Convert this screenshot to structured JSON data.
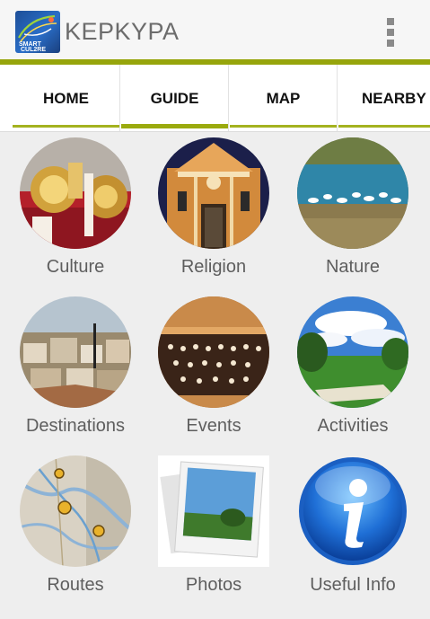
{
  "app": {
    "title": "ΚΕΡΚΥΡΑ",
    "logo_text_top": "SMART",
    "logo_text_bottom": "CUL2RE"
  },
  "tabs": [
    {
      "label": "HOME",
      "active": false
    },
    {
      "label": "GUIDE",
      "active": true
    },
    {
      "label": "MAP",
      "active": false
    },
    {
      "label": "NEARBY",
      "active": false
    }
  ],
  "categories": [
    {
      "label": "Culture"
    },
    {
      "label": "Religion"
    },
    {
      "label": "Nature"
    },
    {
      "label": "Destinations"
    },
    {
      "label": "Events"
    },
    {
      "label": "Activities"
    },
    {
      "label": "Routes"
    },
    {
      "label": "Photos"
    },
    {
      "label": "Useful Info"
    }
  ],
  "colors": {
    "accent": "#96a50b",
    "tab_indicator": "#a4b21f",
    "background": "#eeeeee"
  },
  "icons": {
    "overflow": "overflow-menu-icon",
    "logo": "smart-cul2re-logo"
  }
}
